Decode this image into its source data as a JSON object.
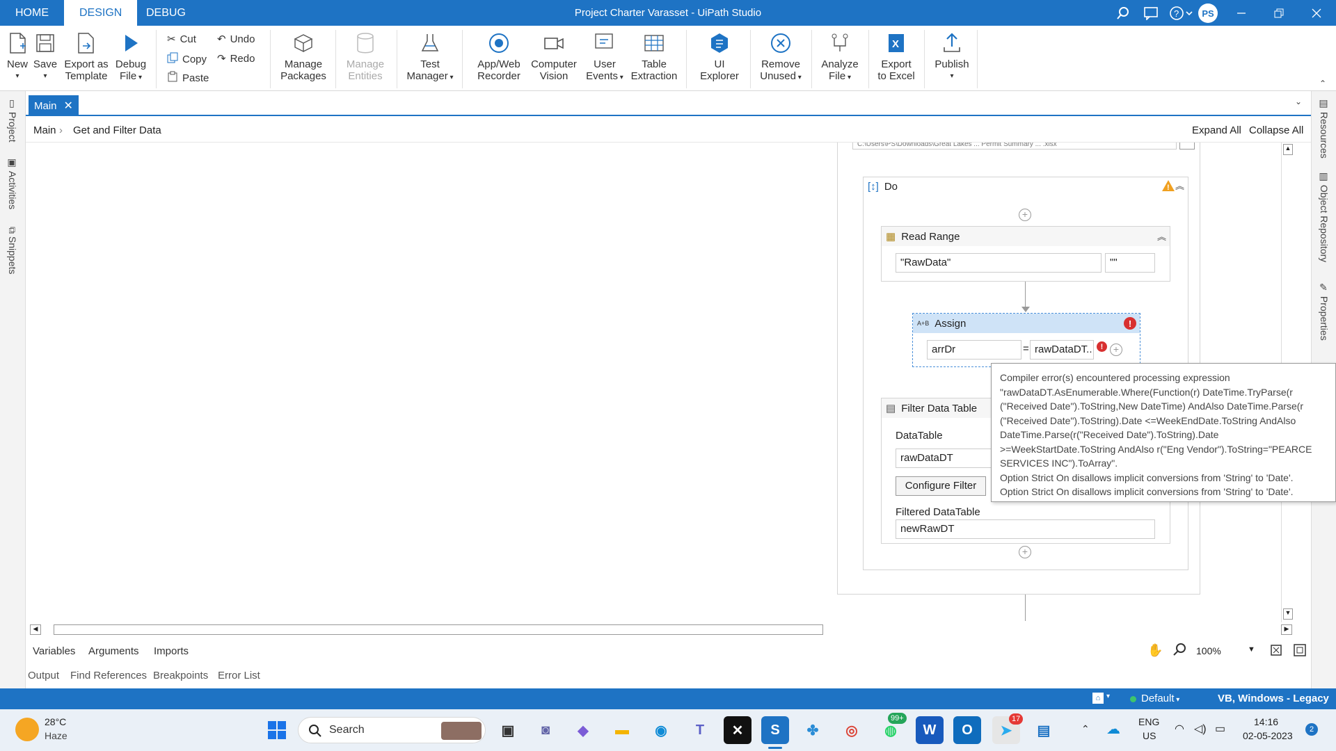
{
  "titlebar": {
    "tabs": [
      "HOME",
      "DESIGN",
      "DEBUG"
    ],
    "app_title": "Project Charter Varasset - UiPath Studio",
    "avatar": "PS",
    "icons": [
      "search-icon",
      "feedback-icon",
      "help-icon",
      "minimize-icon",
      "restore-icon",
      "close-icon"
    ]
  },
  "ribbon": {
    "new": "New",
    "save": "Save",
    "export_template": [
      "Export as",
      "Template"
    ],
    "debug_file": [
      "Debug",
      "File"
    ],
    "cut": "Cut",
    "copy": "Copy",
    "paste": "Paste",
    "undo": "Undo",
    "redo": "Redo",
    "manage_packages": [
      "Manage",
      "Packages"
    ],
    "manage_entities": [
      "Manage",
      "Entities"
    ],
    "test_manager": [
      "Test",
      "Manager"
    ],
    "app_web_recorder": [
      "App/Web",
      "Recorder"
    ],
    "computer_vision": [
      "Computer",
      "Vision"
    ],
    "user_events": [
      "User",
      "Events"
    ],
    "table_extraction": [
      "Table",
      "Extraction"
    ],
    "ui_explorer": [
      "UI",
      "Explorer"
    ],
    "remove_unused": [
      "Remove",
      "Unused"
    ],
    "analyze_file": [
      "Analyze",
      "File"
    ],
    "export_excel": [
      "Export",
      "to Excel"
    ],
    "publish": "Publish"
  },
  "left_panels": [
    "Project",
    "Activities",
    "Snippets"
  ],
  "right_panels": [
    "Resources",
    "Object Repository",
    "Properties"
  ],
  "doc_tab": "Main",
  "breadcrumb": {
    "root": "Main",
    "current": "Get and Filter Data"
  },
  "expand_all": "Expand All",
  "collapse_all": "Collapse All",
  "path_fragment": "C:\\Users\\PS\\Downloads\\Great Lakes ... Permit Summary ... .xlsx",
  "workflow": {
    "do_label": "Do",
    "read_range": {
      "title": "Read Range",
      "sheet": "\"RawData\"",
      "range": "\"\""
    },
    "assign": {
      "title": "Assign",
      "icon_text": "A+B",
      "to": "arrDr",
      "value": "rawDataDT.."
    },
    "filter": {
      "title": "Filter Data Table",
      "datatable_label": "DataTable",
      "datatable": "rawDataDT",
      "configure": "Configure Filter",
      "filtered_label": "Filtered DataTable",
      "filtered": "newRawDT"
    }
  },
  "tooltip": {
    "lines": [
      "Compiler error(s) encountered processing expression",
      "\"rawDataDT.AsEnumerable.Where(Function(r) DateTime.TryParse(r",
      "(\"Received Date\").ToString,New DateTime) AndAlso DateTime.Parse(r",
      "(\"Received Date\").ToString).Date <=WeekEndDate.ToString AndAlso",
      "DateTime.Parse(r(\"Received Date\").ToString).Date",
      ">=WeekStartDate.ToString AndAlso r(\"Eng Vendor\").ToString=\"PEARCE",
      "SERVICES INC\").ToArray\".",
      "Option Strict On disallows implicit conversions from 'String' to 'Date'.",
      "Option Strict On disallows implicit conversions from 'String' to 'Date'."
    ]
  },
  "bottom_tabs": {
    "variables": "Variables",
    "arguments": "Arguments",
    "imports": "Imports"
  },
  "zoom": "100%",
  "output_tabs": [
    "Output",
    "Find References",
    "Breakpoints",
    "Error List"
  ],
  "statusbar": {
    "profile": "Default",
    "language": "VB, Windows - Legacy"
  },
  "taskbar": {
    "weather_temp": "28°C",
    "weather_desc": "Haze",
    "search": "Search",
    "lang1": "ENG",
    "lang2": "US",
    "time": "14:16",
    "date": "02-05-2023",
    "notif_count": "2",
    "whatsapp_badge": "99+",
    "telegram_badge": "17"
  },
  "colors": {
    "accent": "#1e73c4",
    "error": "#d83030",
    "warning": "#f0a020",
    "selection": "#cfe3f7"
  }
}
